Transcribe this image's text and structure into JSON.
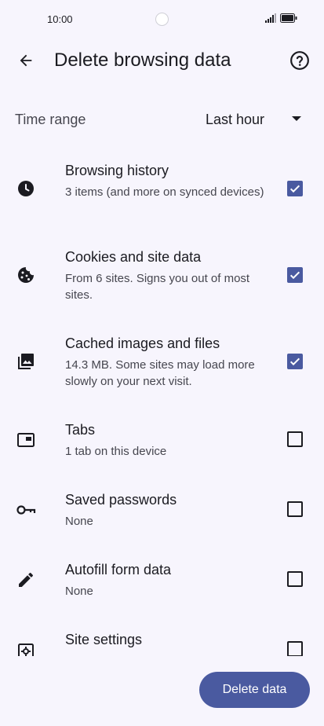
{
  "status_bar": {
    "time": "10:00"
  },
  "app_bar": {
    "title": "Delete browsing data",
    "back_icon": "arrow-back-icon",
    "help_icon": "help-circle-icon"
  },
  "time_range": {
    "label": "Time range",
    "value": "Last hour"
  },
  "options": [
    {
      "title": "Browsing history",
      "subtitle": "3 items (and more on synced devices)",
      "icon": "clock-icon",
      "checked": true
    },
    {
      "title": "Cookies and site data",
      "subtitle": "From 6 sites. Signs you out of most sites.",
      "icon": "cookie-icon",
      "checked": true
    },
    {
      "title": "Cached images and files",
      "subtitle": "14.3 MB. Some sites may load more slowly on your next visit.",
      "icon": "image-stack-icon",
      "checked": true
    },
    {
      "title": "Tabs",
      "subtitle": "1 tab on this device",
      "icon": "tab-icon",
      "checked": false
    },
    {
      "title": "Saved passwords",
      "subtitle": "None",
      "icon": "key-icon",
      "checked": false
    },
    {
      "title": "Autofill form data",
      "subtitle": "None",
      "icon": "pencil-icon",
      "checked": false
    },
    {
      "title": "Site settings",
      "subtitle": "",
      "icon": "site-settings-icon",
      "checked": false
    }
  ],
  "delete_button": {
    "label": "Delete data"
  },
  "colors": {
    "accent": "#4a5aa0",
    "background": "#f7f5fd",
    "text": "#1b1b21"
  }
}
